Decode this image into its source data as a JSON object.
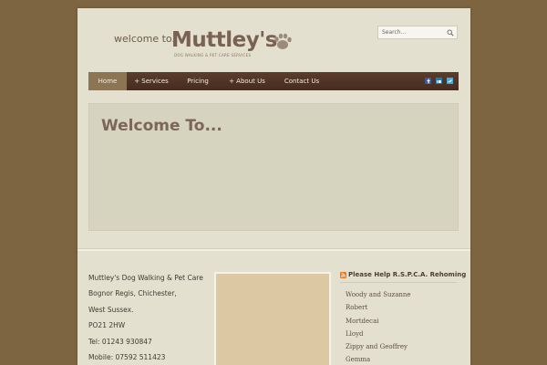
{
  "header": {
    "welcome_text": "welcome to..",
    "brand_name": "Muttley's",
    "tagline": "DOG WALKING & PET CARE SERVICES",
    "search_placeholder": "Search..."
  },
  "nav": {
    "items": [
      {
        "label": "Home",
        "active": true
      },
      {
        "label": "+ Services"
      },
      {
        "label": "Pricing"
      },
      {
        "label": "+ About Us"
      },
      {
        "label": "Contact Us"
      }
    ],
    "social_icons": [
      "facebook-icon",
      "linkedin-icon",
      "twitter-icon"
    ]
  },
  "hero": {
    "title": "Welcome To..."
  },
  "contact": {
    "lines": [
      "Muttley's Dog Walking & Pet Care",
      "Bognor Regis, Chichester,",
      "West Sussex.",
      "PO21 2HW",
      "Tel: 01243 930847",
      "Mobile: 07592 511423"
    ]
  },
  "rehoming": {
    "title": "Please Help R.S.P.C.A. Rehoming",
    "items": [
      "Woody and Suzanne",
      "Robert",
      "Mortdecai",
      "Lloyd",
      "Zippy and Geoffrey",
      "Gemma"
    ]
  },
  "colors": {
    "background": "#7d6541",
    "page": "#e3e0cf",
    "nav": "#4f3426",
    "nav_active": "#8b7552",
    "brand": "#7a6252"
  }
}
